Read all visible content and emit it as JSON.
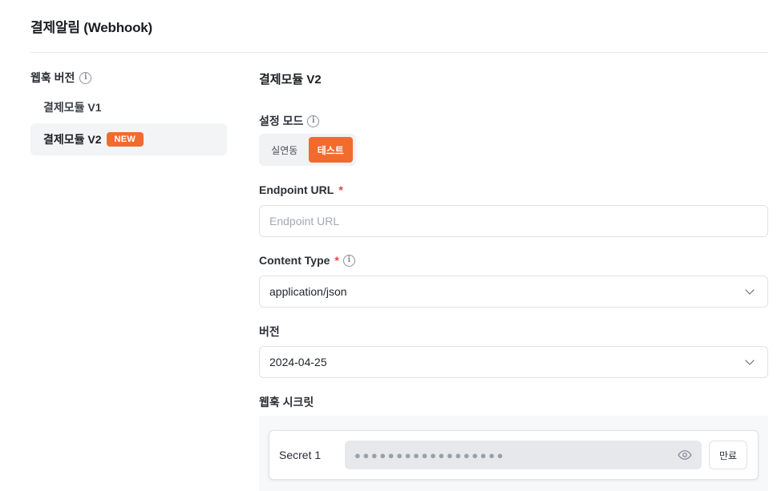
{
  "page": {
    "title": "결제알림 (Webhook)"
  },
  "sidebar": {
    "heading": "웹훅 버전",
    "items": [
      {
        "label": "결제모듈 V1"
      },
      {
        "label": "결제모듈 V2",
        "badge": "NEW"
      }
    ]
  },
  "main": {
    "section_title": "결제모듈 V2",
    "mode": {
      "label": "설정 모드",
      "options": [
        "실연동",
        "테스트"
      ],
      "selected": "테스트"
    },
    "endpoint": {
      "label": "Endpoint URL",
      "required_mark": "*",
      "value": "",
      "placeholder": "Endpoint URL"
    },
    "content_type": {
      "label": "Content Type",
      "required_mark": "*",
      "value": "application/json"
    },
    "version": {
      "label": "버전",
      "value": "2024-04-25"
    },
    "secret": {
      "label": "웹훅 시크릿",
      "items": [
        {
          "name": "Secret 1",
          "masked": "●●●●●●●●●●●●●●●●●●",
          "expire_label": "만료"
        }
      ]
    }
  },
  "colors": {
    "accent": "#f26b2e",
    "required": "#e8413a"
  },
  "icons": [
    "info-icon",
    "chevron-down-icon",
    "eye-icon"
  ]
}
